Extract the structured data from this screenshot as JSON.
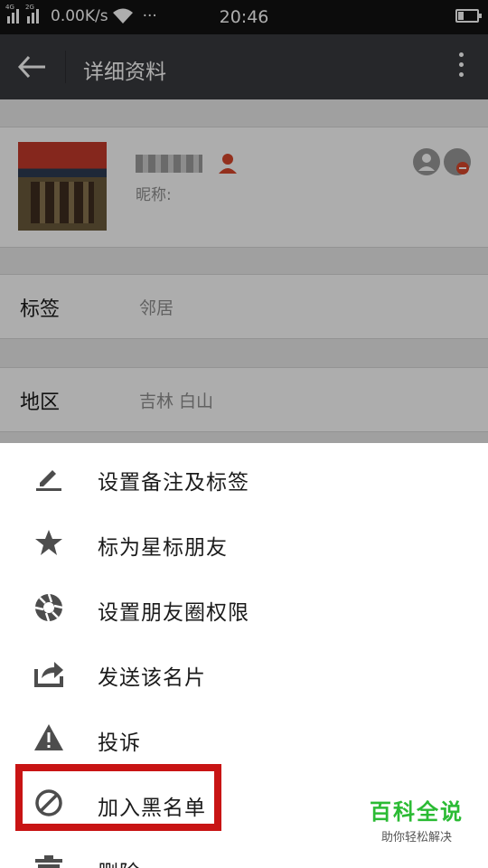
{
  "status_bar": {
    "sim1": "4G",
    "sim2": "2G",
    "speed": "0.00K/s",
    "dots": "···",
    "time": "20:46"
  },
  "app_bar": {
    "title": "详细资料"
  },
  "profile": {
    "nickname": "昵称:"
  },
  "rows": {
    "tags_label": "标签",
    "tags_value": "邻居",
    "region_label": "地区",
    "region_value": "吉林  白山"
  },
  "menu": {
    "items": [
      {
        "label": "设置备注及标签",
        "icon": "edit-icon"
      },
      {
        "label": "标为星标朋友",
        "icon": "star-icon"
      },
      {
        "label": "设置朋友圈权限",
        "icon": "aperture-icon"
      },
      {
        "label": "发送该名片",
        "icon": "share-icon"
      },
      {
        "label": "投诉",
        "icon": "warning-icon"
      },
      {
        "label": "加入黑名单",
        "icon": "block-icon"
      },
      {
        "label": "删除",
        "icon": "trash-icon"
      }
    ]
  },
  "watermark": {
    "title": "百科全说",
    "subtitle": "助你轻松解决"
  },
  "colors": {
    "status_bar": "#121212",
    "app_bar": "#393a3f",
    "highlight": "#c81414",
    "watermark_green": "#2bbb34",
    "icon_gray": "#4d4d4d"
  }
}
